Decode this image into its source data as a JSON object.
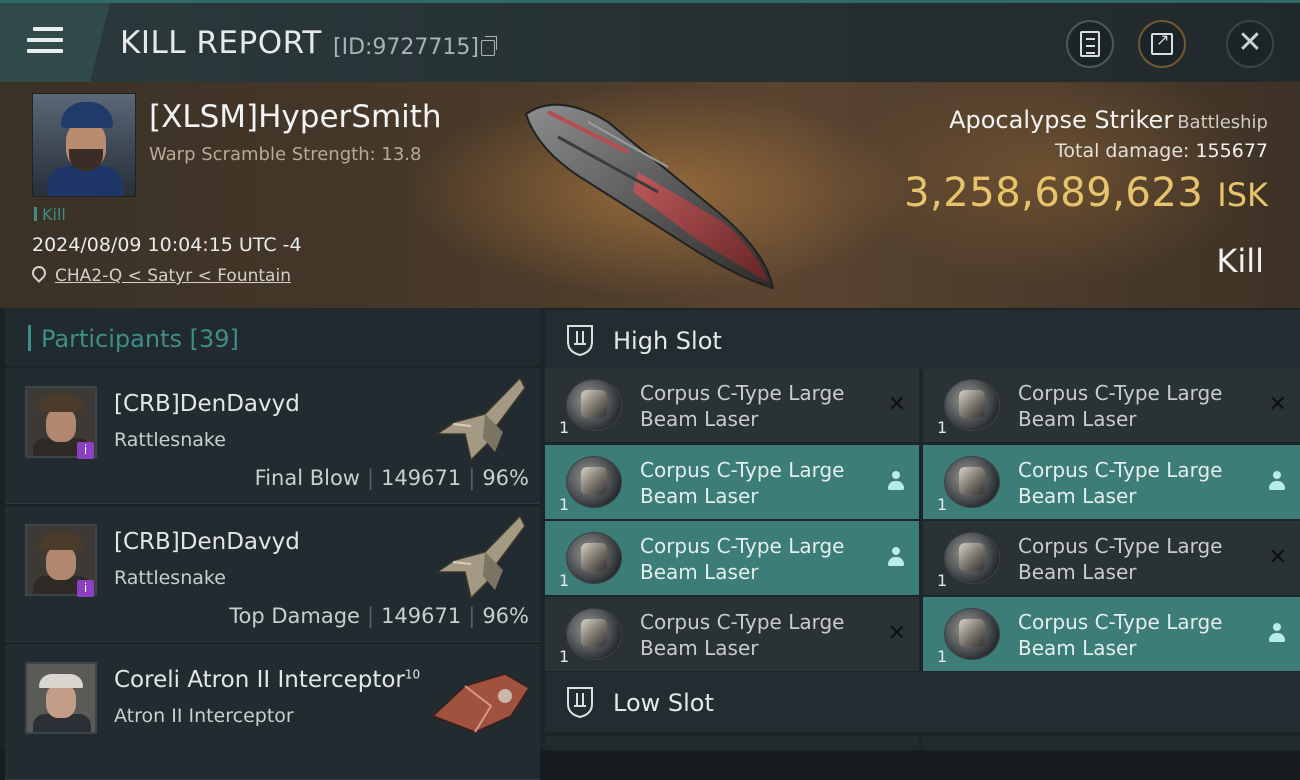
{
  "header": {
    "title": "KILL REPORT",
    "report_id": "[ID:9727715]"
  },
  "victim": {
    "name": "[XLSM]HyperSmith",
    "warp_scramble": "Warp Scramble Strength: 13.8",
    "kill_tag": "Kill",
    "datetime": "2024/08/09 10:04:15 UTC -4",
    "location": "CHA2-Q < Satyr < Fountain"
  },
  "ship": {
    "name": "Apocalypse Striker",
    "class": "Battleship",
    "total_damage_label": "Total damage:",
    "total_damage": "155677",
    "isk_value": "3,258,689,623",
    "isk_unit": "ISK",
    "status": "Kill"
  },
  "participants": {
    "label": "Participants",
    "count": "[39]",
    "items": [
      {
        "name": "[CRB]DenDavyd",
        "ship": "Rattlesnake",
        "role": "Final Blow",
        "damage": "149671",
        "percent": "96%",
        "badge": "i"
      },
      {
        "name": "[CRB]DenDavyd",
        "ship": "Rattlesnake",
        "role": "Top Damage",
        "damage": "149671",
        "percent": "96%",
        "badge": "i"
      },
      {
        "name": "Coreli Atron II Interceptor",
        "name_sup": "10",
        "ship": "Atron II Interceptor"
      }
    ]
  },
  "slots": {
    "high": {
      "title": "High Slot",
      "modules": [
        {
          "name": "Corpus C-Type Large Beam Laser",
          "qty": "1",
          "state": "destroyed"
        },
        {
          "name": "Corpus C-Type Large Beam Laser",
          "qty": "1",
          "state": "destroyed"
        },
        {
          "name": "Corpus C-Type Large Beam Laser",
          "qty": "1",
          "state": "dropped"
        },
        {
          "name": "Corpus C-Type Large Beam Laser",
          "qty": "1",
          "state": "dropped"
        },
        {
          "name": "Corpus C-Type Large Beam Laser",
          "qty": "1",
          "state": "dropped"
        },
        {
          "name": "Corpus C-Type Large Beam Laser",
          "qty": "1",
          "state": "destroyed"
        },
        {
          "name": "Corpus C-Type Large Beam Laser",
          "qty": "1",
          "state": "destroyed"
        },
        {
          "name": "Corpus C-Type Large Beam Laser",
          "qty": "1",
          "state": "dropped"
        }
      ]
    },
    "low": {
      "title": "Low Slot"
    }
  },
  "icons": {
    "destroyed": "✕",
    "badge_color": "#8b3fc1",
    "accent": "#3d7d77",
    "isk_color": "#e7c46c"
  }
}
